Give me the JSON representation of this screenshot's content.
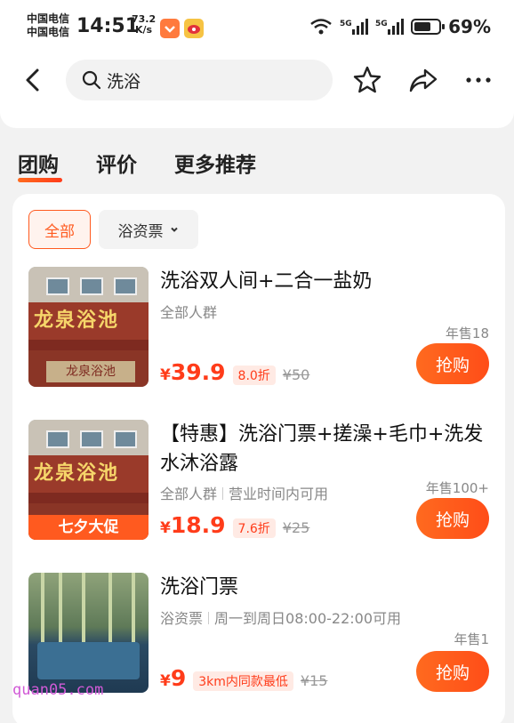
{
  "status_bar": {
    "carrier_1": "中国电信",
    "carrier_2": "中国电信",
    "time": "14:51",
    "speed_value": "73.2",
    "speed_unit": "K/s",
    "battery": "69%"
  },
  "nav": {
    "search_text": "洗浴"
  },
  "tabs": [
    {
      "label": "团购",
      "active": true
    },
    {
      "label": "评价",
      "active": false
    },
    {
      "label": "更多推荐",
      "active": false
    }
  ],
  "filters": {
    "all": "全部",
    "type": "浴资票"
  },
  "items": [
    {
      "title": "洗浴双人间+二合一盐奶",
      "meta": [
        "全部人群"
      ],
      "sales": "年售18",
      "currency": "¥",
      "price": "39.9",
      "discount": "8.0折",
      "original_price": "¥50",
      "buy_label": "抢购",
      "thumb_sign": "龙泉浴池",
      "thumb_sub": "龙泉浴池"
    },
    {
      "title": "【特惠】洗浴门票+搓澡+毛巾+洗发水沐浴露",
      "meta": [
        "全部人群",
        "营业时间内可用"
      ],
      "sales": "年售100+",
      "currency": "¥",
      "price": "18.9",
      "discount": "7.6折",
      "original_price": "¥25",
      "buy_label": "抢购",
      "thumb_sign": "龙泉浴池",
      "thumb_promo": "七夕大促"
    },
    {
      "title": "洗浴门票",
      "meta": [
        "浴资票",
        "周一到周日08:00-22:00可用"
      ],
      "sales": "年售1",
      "currency": "¥",
      "price": "9",
      "discount": "3km内同款最低",
      "original_price": "¥15",
      "buy_label": "抢购"
    }
  ],
  "watermark": "quan05.com",
  "colors": {
    "accent": "#ff4d18",
    "price": "#ff3c1a",
    "background": "#f2f2f2"
  },
  "icons": [
    "back-arrow-icon",
    "search-icon",
    "star-icon",
    "share-icon",
    "more-icon",
    "chevron-down-icon",
    "wifi-icon",
    "signal-icon",
    "battery-icon"
  ]
}
